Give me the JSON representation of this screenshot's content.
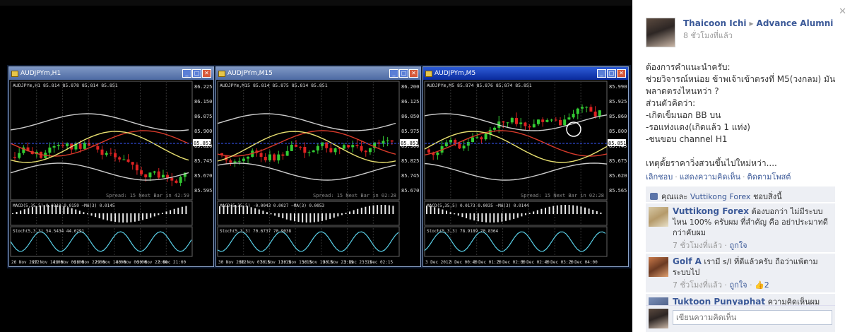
{
  "charts": [
    {
      "window_title": "AUDJPYm,H1",
      "info": "AUDJPYm,H1  85.814 85.878 85.814 85.851",
      "price_tag": "85.851",
      "levels": [
        "86.225",
        "86.150",
        "86.075",
        "85.900",
        "85.820",
        "85.745",
        "85.670",
        "85.595"
      ],
      "spread_text": "Spread: 15   Next Bar in 42:59",
      "macd_label": "MACD(5,35,5) 0.0310 0.0159 ~MA(3) 0.0145",
      "stoch_label": "Stoch(5,3,3) 54.5434 44.6291",
      "dates": [
        "26 Nov 2012",
        "27 Nov 14:00",
        "28 Nov 06:00",
        "28 Nov 22:00",
        "29 Nov 14:00",
        "30 Nov 06:00",
        "30 Nov 22:00",
        "3 Dec 21:00"
      ]
    },
    {
      "window_title": "AUDJPYm,M15",
      "info": "AUDJPYm,M15  85.814 85.875 85.814 85.851",
      "price_tag": "85.851",
      "levels": [
        "86.200",
        "86.125",
        "86.050",
        "85.975",
        "85.900",
        "85.825",
        "85.745",
        "85.670"
      ],
      "spread_text": "Spread: 15   Next Bar in 02:28",
      "macd_label": "MACD(5,35,5) -0.0043 0.0027 ~MA(3) 0.0053",
      "stoch_label": "Stoch(5,3,3) 70.6737 70.9038",
      "dates": [
        "30 Nov 2012",
        "30 Nov 07:15",
        "30 Nov 11:15",
        "30 Nov 15:15",
        "30 Nov 19:15",
        "30 Nov 23:15",
        "2 Dec 23:15",
        "3 Dec 02:15"
      ]
    },
    {
      "window_title": "AUDJPYm,M5",
      "info": "AUDJPYm,M5  85.874 85.876 85.874 85.851",
      "price_tag": "85.851",
      "levels": [
        "85.990",
        "85.925",
        "85.860",
        "85.800",
        "85.745",
        "85.675",
        "85.620",
        "85.565"
      ],
      "spread_text": "Spread: 15   Next Bar in 02:28",
      "macd_label": "MACD(5,35,5) 0.0173 0.0035 ~MA(3) 0.0144",
      "stoch_label": "Stoch(5,3,3) 78.9189 70.8364",
      "dates": [
        "3 Dec 2012",
        "3 Dec 00:40",
        "3 Dec 01:20",
        "3 Dec 02:00",
        "3 Dec 02:40",
        "3 Dec 03:20",
        "3 Dec 04:00"
      ]
    }
  ],
  "post": {
    "author": "Thaicoon Ichi",
    "group": "Advance Alumni",
    "time": "8 ชั่วโมงที่แล้ว",
    "message": "ต้องการคำแนะนำครับ:\nช่วยวิจารณ์หน่อย ข้าพเจ้าเข้าตรงที่ M5(วงกลม) มันพลาดตรงไหนหว่า ?\nส่วนตัวคิดว่า:\n-เกิดเข็มนอก BB บน\n-รอแท่งแดง(เกิดแล้ว 1 แท่ง)\n-ชนขอบ channel H1\n\nเหตุดั้ยราคาวิ่งสวนขึ้นไปใหม่หว่า....",
    "actions": [
      "เลิกชอบ",
      "แสดงความคิดเห็น",
      "ติดตามโพสต์"
    ],
    "likes_prefix": "คุณและ",
    "likes_name": "Vuttikong Forex",
    "likes_suffix": "ชอบสิ่งนี้"
  },
  "comments": [
    {
      "name": "Vuttikong Forex",
      "text": "ต้องบอกว่า ไม่มีระบบไหน 100% ครับผม ที่สำคัญ คือ อย่าประมาทดีกว่าคับผม",
      "time": "7 ชั่วโมงที่แล้ว",
      "like": "ถูกใจ",
      "count": ""
    },
    {
      "name": "Golf A",
      "text": "เรามี s/l ที่ดีแล้วครับ ถือว่าแพ้ตามระบบไป",
      "time": "7 ชั่วโมงที่แล้ว",
      "like": "ถูกใจ",
      "count": "2"
    },
    {
      "name": "Tuktoon Punyaphat",
      "text": "ความคิดเห็นผม",
      "time": "",
      "like": "",
      "count": ""
    }
  ],
  "composer": {
    "placeholder": "เขียนความคิดเห็น"
  },
  "colors": {
    "link": "#3b5998",
    "bull": "#33cc33",
    "bear": "#dd2222",
    "bg_panel": "#edeff4"
  }
}
